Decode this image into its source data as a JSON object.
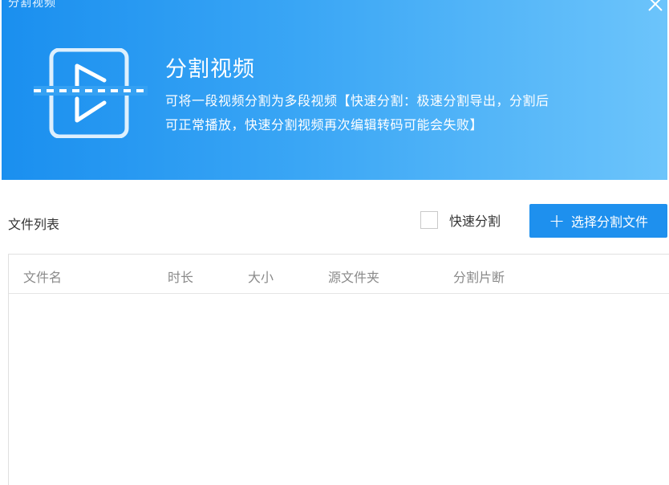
{
  "window": {
    "title": "分割视频"
  },
  "banner": {
    "title": "分割视频",
    "description_line1": "可将一段视频分割为多段视频【快速分割：极速分割导出，分割后",
    "description_line2": "可正常播放，快速分割视频再次编辑转码可能会失败】",
    "icon": "video-split-icon"
  },
  "toolbar": {
    "section_title": "文件列表",
    "fast_split_label": "快速分割",
    "fast_split_checked": false,
    "select_button_label": "选择分割文件",
    "select_button_icon": "plus-icon"
  },
  "table": {
    "columns": [
      "文件名",
      "时长",
      "大小",
      "源文件夹",
      "分割片断"
    ],
    "rows": []
  },
  "colors": {
    "banner_start": "#1a8fef",
    "banner_end": "#6cc4fb",
    "accent_button": "#1e90ee"
  }
}
